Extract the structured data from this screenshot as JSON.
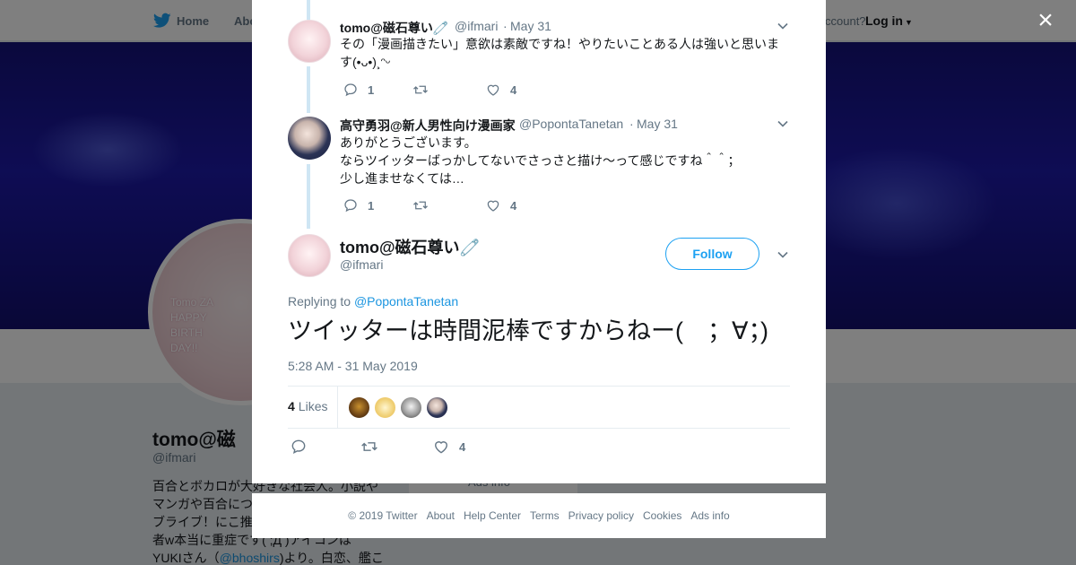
{
  "background": {
    "nav": {
      "home": "Home",
      "about": "Abo",
      "account_question": "ccount?",
      "login": "Log in"
    },
    "profile": {
      "avatar_text": [
        "Tomo ZA",
        "HAPPY",
        "BIRTH",
        "DAY!!"
      ],
      "name": "tomo@磁",
      "handle": "@ifmari",
      "bio_lines": [
        "百合とボカロが大好きな社会人。小説や",
        "マンガや百合につ",
        "ブライブ！にこ推",
        "者w本当に重症です( ;Д )アイコンは"
      ],
      "bio_last_prefix": "YUKIさん（",
      "bio_mention": "@bhoshirs",
      "bio_last_suffix": ")より。白恋、艦こ"
    },
    "side_card_text": "Ads info"
  },
  "modal": {
    "close_label": "×",
    "replies": [
      {
        "name": "tomo@磁石尊い🧷",
        "handle": "@ifmari",
        "date": "May 31",
        "text_lines": [
          "その「漫画描きたい」意欲は素敵ですね！やりたいことある人は強いと思いま",
          "す(•ᴗ•)¸ᵔᵕ"
        ],
        "replies": "1",
        "retweets": "",
        "likes": "4"
      },
      {
        "name": "高守勇羽@新人男性向け漫画家",
        "handle": "@PopontaTanetan",
        "date": "May 31",
        "text_lines": [
          "ありがとうございます。",
          "ならツイッターばっかしてないでさっさと描け～って感じですね＾＾；",
          "少し進ませなくては…"
        ],
        "replies": "1",
        "retweets": "",
        "likes": "4"
      }
    ],
    "main_tweet": {
      "name": "tomo@磁石尊い🧷",
      "handle": "@ifmari",
      "follow_label": "Follow",
      "replying_prefix": "Replying to",
      "replying_to": "@PopontaTanetan",
      "text": "ツイッターは時間泥棒ですからねー(　；∀；)",
      "timestamp": "5:28 AM - 31 May 2019",
      "likes_count": "4",
      "likes_label": "Likes",
      "action_likes": "4"
    }
  },
  "footer": {
    "links": [
      "© 2019 Twitter",
      "About",
      "Help Center",
      "Terms",
      "Privacy policy",
      "Cookies",
      "Ads info"
    ]
  },
  "colors": {
    "accent": "#1da1f2",
    "link": "#1b95e0",
    "muted": "#657786",
    "thread_line": "#cfe6f4"
  }
}
